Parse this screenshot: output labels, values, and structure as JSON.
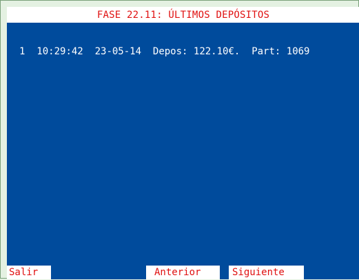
{
  "screen": {
    "title": "FASE 22.11: ÚLTIMOS DEPÓSITOS"
  },
  "deposits": [
    {
      "index": "1",
      "time": "10:29:42",
      "date": "23-05-14",
      "amount_label": "Depos: 122.10€.",
      "part_label": "Part: 1069"
    }
  ],
  "function_keys": {
    "exit_label": "Salir",
    "previous_label": "Anterior",
    "next_label": "Siguiente"
  },
  "colors": {
    "background": "#004b9c",
    "title_text": "#e01010",
    "title_background": "#ffffff",
    "body_text": "#ffffff",
    "outer_frame": "#e4f1e2"
  }
}
